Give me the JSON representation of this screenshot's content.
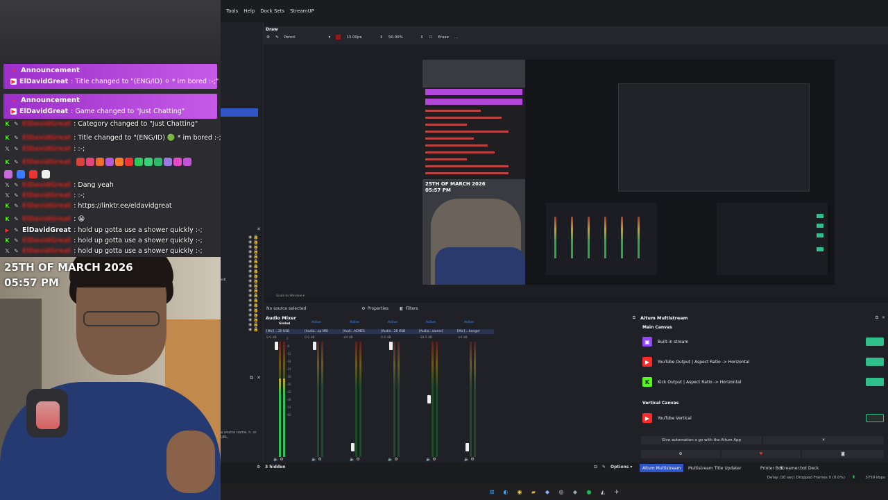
{
  "menu": [
    "Tools",
    "Help",
    "Dock Sets",
    "StreamUP"
  ],
  "draw_dock": {
    "title": "Draw",
    "tool": "Pencil",
    "size": "13.00px",
    "opacity": "50.00%",
    "erase_label": "Erase",
    "ellipsis": "..."
  },
  "colors": {
    "accent": "#2f55c6",
    "announcement": "#b347d9",
    "kick_green": "#53fc18",
    "toggle_green": "#2fbf8a",
    "youtube_red": "#ff2a2a",
    "twitch_purple": "#9146ff"
  },
  "chat": {
    "announcements": [
      {
        "title": "Announcement",
        "user": "ElDavidGreat",
        "message": ": Title changed to \"(ENG/ID) ⚪ * im bored :-;\""
      },
      {
        "title": "Announcement",
        "user": "ElDavidGreat",
        "message": ": Game changed to \"Just Chatting\""
      }
    ],
    "lines": [
      {
        "platform": "kick",
        "user": "ElDavidGreat",
        "message": ": Category changed to \"Just Chatting\"",
        "blurred": true
      },
      {
        "platform": "kick",
        "user": "ElDavidGreat",
        "message": ": Title changed to \"(ENG/ID) 🟢 * im bored :-;\"",
        "blurred": true
      },
      {
        "platform": "x",
        "user": "ElDavidGreat",
        "message": ": :-;",
        "blurred": true
      },
      {
        "platform": "kick",
        "user": "ElDavidGreat",
        "message": "",
        "blurred": true
      },
      {
        "platform": "x",
        "user": "ElDavidGreat",
        "message": ": Dang yeah",
        "blurred": true
      },
      {
        "platform": "x",
        "user": "ElDavidGreat",
        "message": ": :-;",
        "blurred": true
      },
      {
        "platform": "kick",
        "user": "ElDavidGreat",
        "message": ": https://linktr.ee/eldavidgreat",
        "blurred": true
      },
      {
        "platform": "kick",
        "user": "ElDavidGreat",
        "message": ": 😁",
        "blurred": true
      },
      {
        "platform": "yt",
        "user": "ElDavidGreat",
        "message": ": hold up gotta use a shower quickly :-;",
        "blurred": false
      },
      {
        "platform": "kick",
        "user": "ElDavidGreat",
        "message": ": hold up gotta use a shower quickly :-;",
        "blurred": true
      },
      {
        "platform": "x",
        "user": "ElDavidGreat",
        "message": ": hold up gotta use a shower quickly :-;",
        "blurred": true
      }
    ]
  },
  "cam": {
    "date": "25TH OF MARCH 2026",
    "time": "05:57 PM"
  },
  "preview": {
    "scale_label": "Scale to Window"
  },
  "sources_bar": {
    "no_source": "No source selected",
    "properties": "Properties",
    "filters": "Filters"
  },
  "left_dock": {
    "hint": "a source name, h, or URL.",
    "stray": "ed)"
  },
  "audio_mixer": {
    "title": "Audio Mixer",
    "global_label": "Global",
    "channels": [
      {
        "status": "Active",
        "name": "[Mic] ...20 USB",
        "db": "0.0 dB",
        "level": 0.68,
        "fader": 1.0
      },
      {
        "status": "Active",
        "name": "[Audio...op MSI",
        "db": "0.0 dB",
        "level": 0.0,
        "fader": 1.0
      },
      {
        "status": "Active",
        "name": "[Audi...ACMES",
        "db": "-inf dB",
        "level": 0.0,
        "fader": 0.05
      },
      {
        "status": "Active",
        "name": "[Audio...20 USB",
        "db": "0.0 dB",
        "level": 0.0,
        "fader": 1.0
      },
      {
        "status": "Active",
        "name": "[Audio...olume]",
        "db": "-18.5 dB",
        "level": 0.0,
        "fader": 0.5
      },
      {
        "status": "Active",
        "name": "[Mic] ...hanger",
        "db": "-inf dB",
        "level": 0.0,
        "fader": 0.05
      }
    ],
    "ticks": [
      "0",
      "-6",
      "-12",
      "-18",
      "-24",
      "-30",
      "-36",
      "-42",
      "-48",
      "-54",
      "-60"
    ]
  },
  "multistream": {
    "title": "Aitum Multistream",
    "main_canvas": "Main Canvas",
    "vertical_canvas": "Vertical Canvas",
    "main_outputs": [
      {
        "icon": "twitch-icon",
        "label": "Built-in stream",
        "on": true
      },
      {
        "icon": "youtube-icon",
        "label": "YouTube Output | Aspect Ratio -> Horizontal",
        "on": true
      },
      {
        "icon": "kick-icon",
        "label": "Kick Output | Aspect Ratio -> Horizontal",
        "on": true
      }
    ],
    "vertical_outputs": [
      {
        "icon": "youtube-icon",
        "label": "YouTube Vertical",
        "on": false
      }
    ],
    "automation_button": "Give automation a go with the Aitum App"
  },
  "scene_footer": {
    "hidden": "3 hidden",
    "options": "Options",
    "tabs": [
      "Aitum Multistream",
      "Multistream Title Updater",
      "Printer Bot",
      "Streamer.bot Deck"
    ]
  },
  "status": {
    "text": "Delay (10 sec) Dropped Frames 0 (0.0%)",
    "bitrate": "3759 kbps"
  }
}
